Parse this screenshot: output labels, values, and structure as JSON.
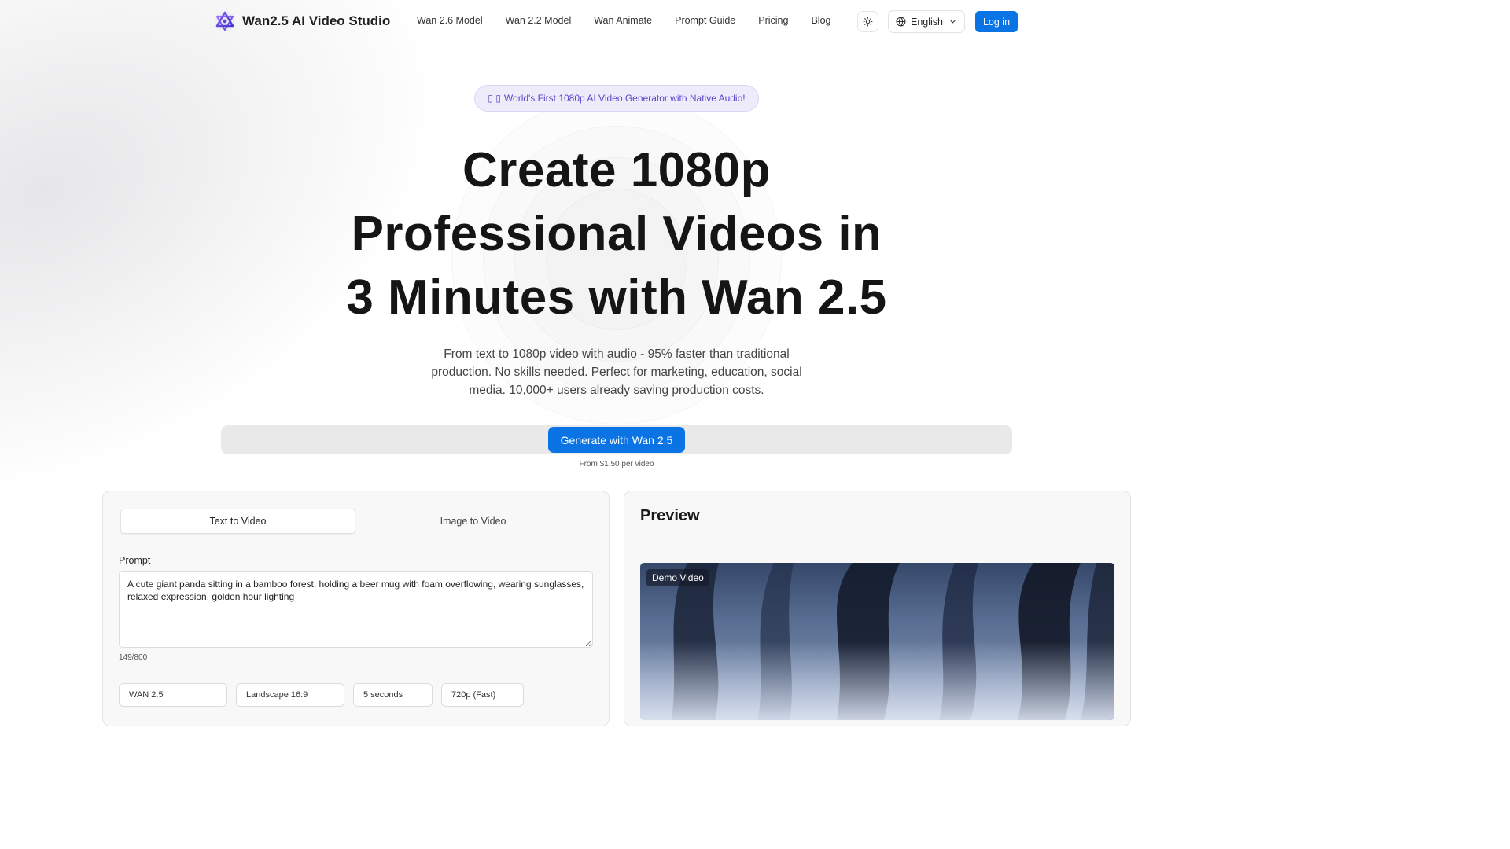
{
  "nav": {
    "brand": "Wan2.5 AI Video Studio",
    "links": [
      "Wan 2.6 Model",
      "Wan 2.2 Model",
      "Wan Animate",
      "Prompt Guide",
      "Pricing",
      "Blog"
    ],
    "language": "English",
    "login_label": "Log in",
    "icons": {
      "logo": "wan-logo-icon",
      "theme": "sun-icon",
      "language": "globe-icon",
      "dropdown": "chevron-down-icon"
    }
  },
  "hero": {
    "badge_icons": "▯ ▯",
    "badge_text": "World's First 1080p AI Video Generator with Native Audio!",
    "headline_lines": [
      "Create 1080p",
      "Professional Videos in",
      "3 Minutes with Wan 2.5"
    ],
    "subhead": "From text to 1080p video with audio - 95% faster than traditional production. No skills needed. Perfect for marketing, education, social media. 10,000+ users already saving production costs.",
    "cta_label": "Generate with Wan 2.5",
    "cta_note": "From $1.50 per video"
  },
  "generator": {
    "tabs": [
      "Text to Video",
      "Image to Video"
    ],
    "active_tab": 0,
    "prompt_label": "Prompt",
    "prompt_value": "A cute giant panda sitting in a bamboo forest, holding a beer mug with foam overflowing, wearing sunglasses, relaxed expression, golden hour lighting",
    "char_count": "149/800",
    "selects": [
      "WAN 2.5",
      "Landscape 16:9",
      "5 seconds",
      "720p (Fast)"
    ]
  },
  "preview": {
    "title": "Preview",
    "video_tag": "Demo Video"
  },
  "colors": {
    "accent": "#0a74e4",
    "badge_text": "#5b45c9",
    "badge_bg": "#eeecfb"
  }
}
